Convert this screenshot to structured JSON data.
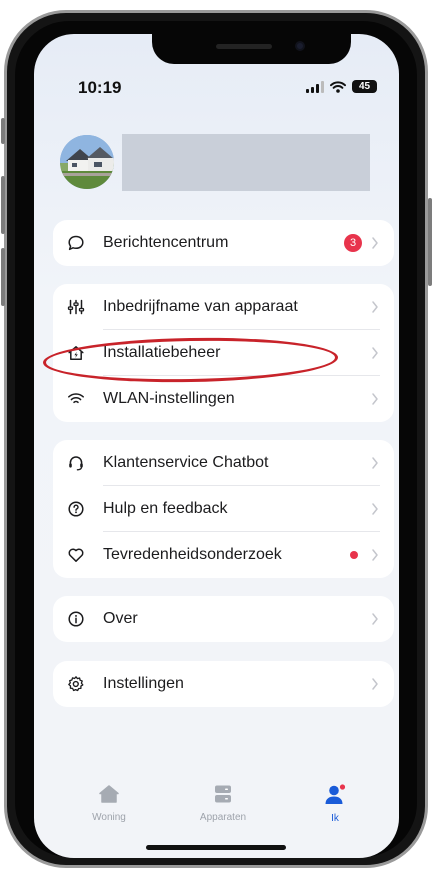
{
  "status": {
    "time": "10:19",
    "battery": "45"
  },
  "profile": {
    "name": ""
  },
  "groups": [
    [
      {
        "icon": "chat-bubble-icon",
        "label": "Berichtencentrum",
        "badge": "3"
      }
    ],
    [
      {
        "icon": "sliders-icon",
        "label": "Inbedrijfname van apparaat"
      },
      {
        "icon": "house-bolt-icon",
        "label": "Installatiebeheer"
      },
      {
        "icon": "wifi-icon",
        "label": "WLAN-instellingen"
      }
    ],
    [
      {
        "icon": "headset-icon",
        "label": "Klantenservice Chatbot"
      },
      {
        "icon": "question-circle-icon",
        "label": "Hulp en feedback"
      },
      {
        "icon": "heart-icon",
        "label": "Tevredenheidsonderzoek",
        "dot": true
      }
    ],
    [
      {
        "icon": "info-circle-icon",
        "label": "Over"
      }
    ],
    [
      {
        "icon": "gear-icon",
        "label": "Instellingen"
      }
    ]
  ],
  "tabbar": {
    "tabs": [
      {
        "label": "Woning",
        "icon": "home-icon",
        "active": false
      },
      {
        "label": "Apparaten",
        "icon": "devices-icon",
        "active": false
      },
      {
        "label": "Ik",
        "icon": "person-icon",
        "active": true
      }
    ]
  },
  "colors": {
    "accent": "#1a5bd8",
    "badge": "#e8344c",
    "annotation": "#c8232a"
  }
}
